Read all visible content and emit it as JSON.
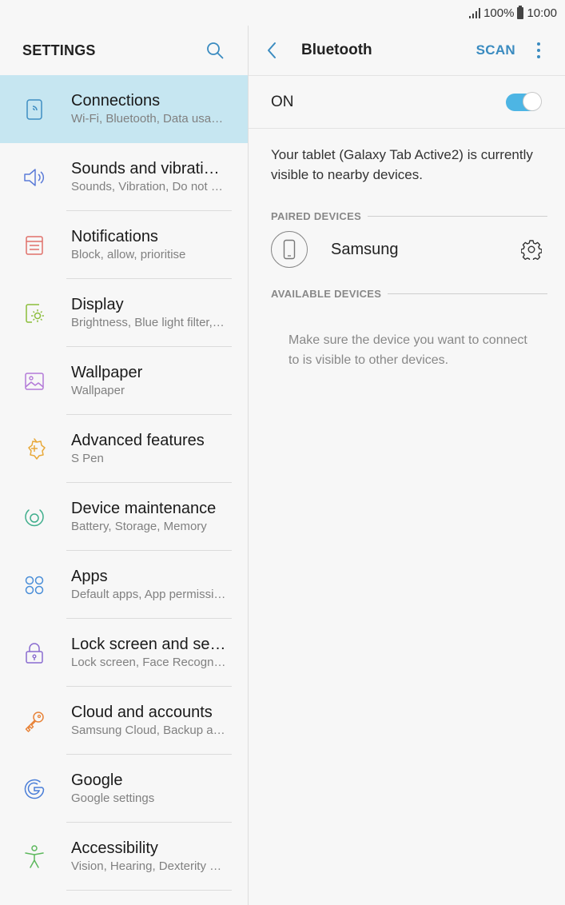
{
  "status_bar": {
    "battery": "100%",
    "time": "10:00"
  },
  "left_pane": {
    "title": "SETTINGS",
    "items": [
      {
        "label": "Connections",
        "sub": "Wi-Fi, Bluetooth, Data usag…",
        "icon": "connections-icon",
        "color": "#3f8ec3",
        "active": true
      },
      {
        "label": "Sounds and vibrati…",
        "sub": "Sounds, Vibration, Do not di…",
        "icon": "speaker-icon",
        "color": "#5b7bd8"
      },
      {
        "label": "Notifications",
        "sub": "Block, allow, prioritise",
        "icon": "notifications-icon",
        "color": "#e0706a"
      },
      {
        "label": "Display",
        "sub": "Brightness, Blue light filter,…",
        "icon": "display-icon",
        "color": "#8bbd3a"
      },
      {
        "label": "Wallpaper",
        "sub": "Wallpaper",
        "icon": "wallpaper-icon",
        "color": "#b47ad8"
      },
      {
        "label": "Advanced features",
        "sub": "S Pen",
        "icon": "advanced-features-icon",
        "color": "#e8a93a"
      },
      {
        "label": "Device maintenance",
        "sub": "Battery, Storage, Memory",
        "icon": "device-maintenance-icon",
        "color": "#3fae8c"
      },
      {
        "label": "Apps",
        "sub": "Default apps, App permissi…",
        "icon": "apps-icon",
        "color": "#4a8ed8"
      },
      {
        "label": "Lock screen and se…",
        "sub": "Lock screen, Face Recognit…",
        "icon": "lock-icon",
        "color": "#8a6cd0"
      },
      {
        "label": "Cloud and accounts",
        "sub": "Samsung Cloud, Backup an…",
        "icon": "key-icon",
        "color": "#e8843a"
      },
      {
        "label": "Google",
        "sub": "Google settings",
        "icon": "google-icon",
        "color": "#4a7ed8"
      },
      {
        "label": "Accessibility",
        "sub": "Vision, Hearing, Dexterity a…",
        "icon": "accessibility-icon",
        "color": "#5cb85c"
      }
    ]
  },
  "right_pane": {
    "title": "Bluetooth",
    "scan_label": "SCAN",
    "toggle_label": "ON",
    "toggle_on": true,
    "visibility_text": "Your tablet (Galaxy Tab Active2) is currently visible to nearby devices.",
    "paired_header": "PAIRED DEVICES",
    "paired_devices": [
      {
        "name": "Samsung"
      }
    ],
    "available_header": "AVAILABLE DEVICES",
    "available_note": "Make sure the device you want to connect to is visible to other devices."
  },
  "colors": {
    "accent": "#3a8bc0",
    "toggle": "#4db5e4",
    "active_row": "#c6e6f1"
  }
}
